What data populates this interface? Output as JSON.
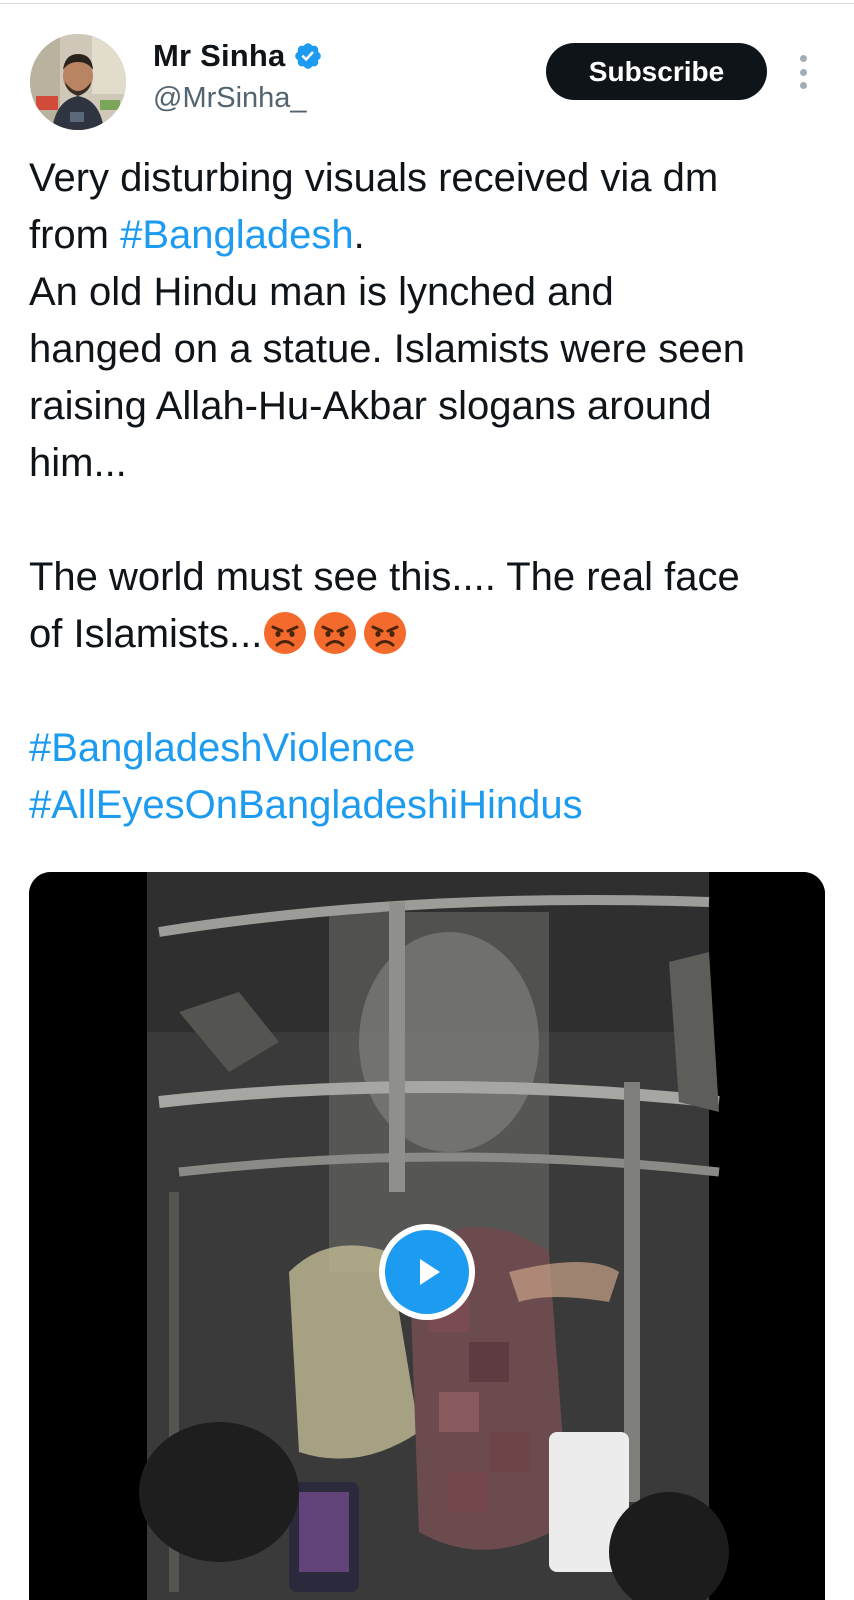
{
  "author": {
    "display_name": "Mr Sinha",
    "handle": "@MrSinha_",
    "verified": true,
    "avatar_icon": "profile-photo"
  },
  "subscribe_label": "Subscribe",
  "more_icon": "vertical-ellipsis-icon",
  "post": {
    "l1": "Very disturbing visuals received via dm",
    "l2_text": "from ",
    "l2_tag": "#Bangladesh",
    "l2_end": ".",
    "l3": "An old Hindu man is lynched and",
    "l4": "hanged on a statue. Islamists were seen",
    "l5": "raising Allah-Hu-Akbar slogans around",
    "l6": "him...",
    "l7": "The world must see this.... The real face",
    "l8": "of Islamists...",
    "emojis": [
      "angry-face-emoji",
      "angry-face-emoji",
      "angry-face-emoji"
    ],
    "tag1": "#BangladeshViolence",
    "tag2": "#AllEyesOnBangladeshiHindus"
  },
  "media": {
    "type": "video",
    "play_icon": "play-icon"
  },
  "colors": {
    "link": "#1d9bf0",
    "text": "#0f1419",
    "secondary": "#536471",
    "button_bg": "#0f1419"
  }
}
